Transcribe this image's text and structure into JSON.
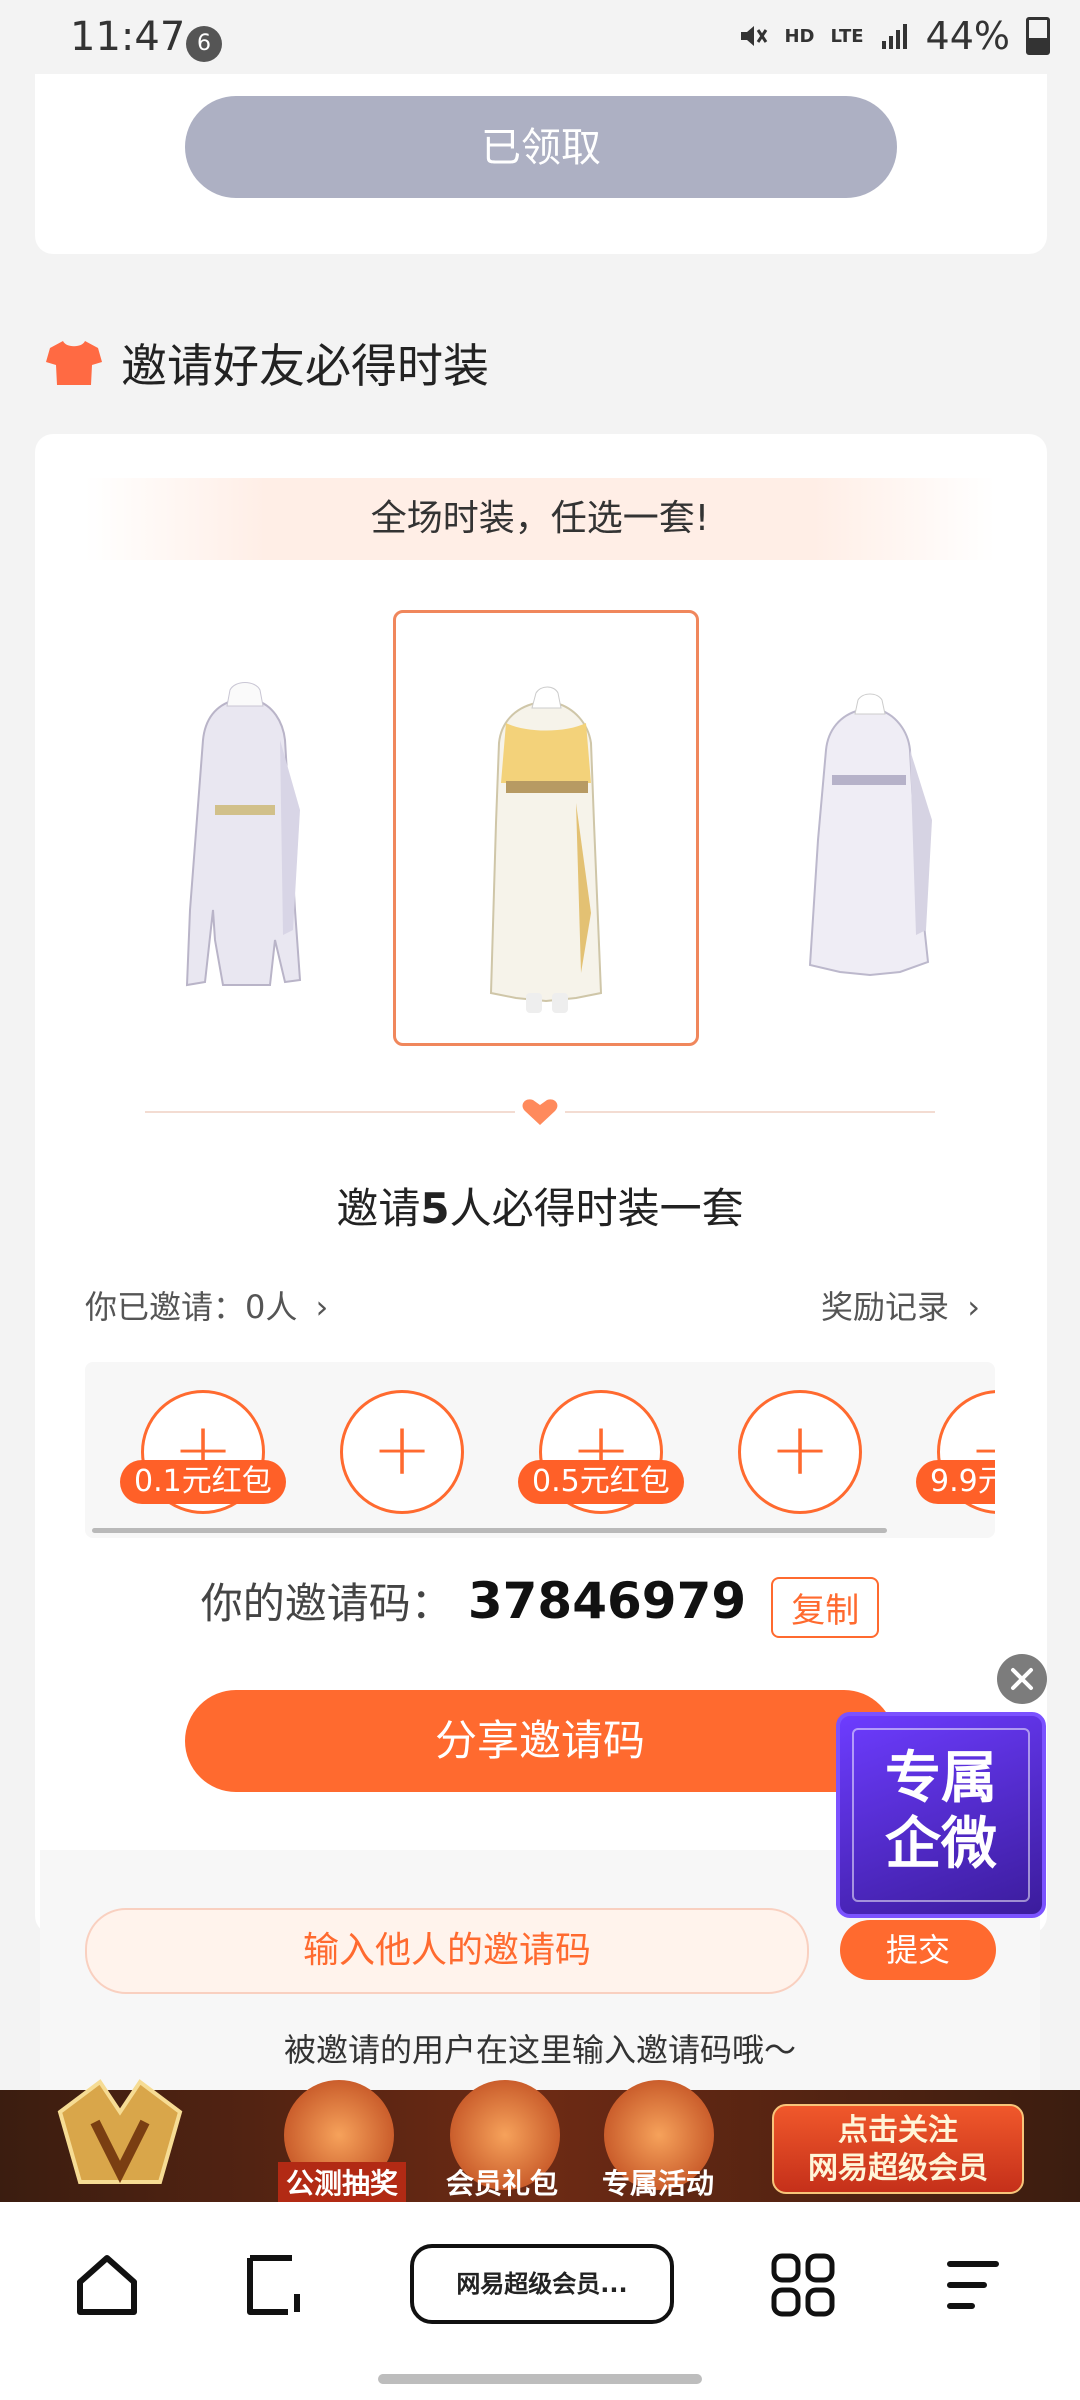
{
  "status_bar": {
    "time": "11:47",
    "notification_count": "6",
    "network": "HD",
    "lte": "LTE",
    "battery": "44%"
  },
  "card_top": {
    "claimed_label": "已领取"
  },
  "section": {
    "title": "邀请好友必得时装"
  },
  "invite_card": {
    "banner": "全场时装，任选一套!",
    "outfits": [
      {
        "name": "outfit-left",
        "selected": false
      },
      {
        "name": "outfit-middle",
        "selected": true
      },
      {
        "name": "outfit-right",
        "selected": false
      }
    ],
    "invite_title_prefix": "邀请",
    "invite_title_count": "5",
    "invite_title_suffix": "人必得时装一套",
    "invited_label": "你已邀请：0人",
    "records_label": "奖励记录",
    "reward_tags": [
      "0.1元红包",
      "0.5元红包",
      "9.9元"
    ],
    "code_label": "你的邀请码：",
    "code_value": "37846979",
    "copy_label": "复制",
    "share_label": "分享邀请码",
    "input_placeholder": "输入他人的邀请码",
    "submit_label": "提交",
    "hint": "被邀请的用户在这里输入邀请码哦～"
  },
  "floating_badge": {
    "line1": "专属",
    "line2": "企微"
  },
  "promo": {
    "items": [
      "公测抽奖",
      "会员礼包",
      "专属活动"
    ],
    "cta_line1": "点击关注",
    "cta_line2": "网易超级会员"
  },
  "bottom_nav": {
    "url_label": "网易超级会员..."
  },
  "colors": {
    "accent": "#ff6a2f",
    "claimed_gray": "#adb0c3",
    "badge_purple": "#5b30e0"
  }
}
